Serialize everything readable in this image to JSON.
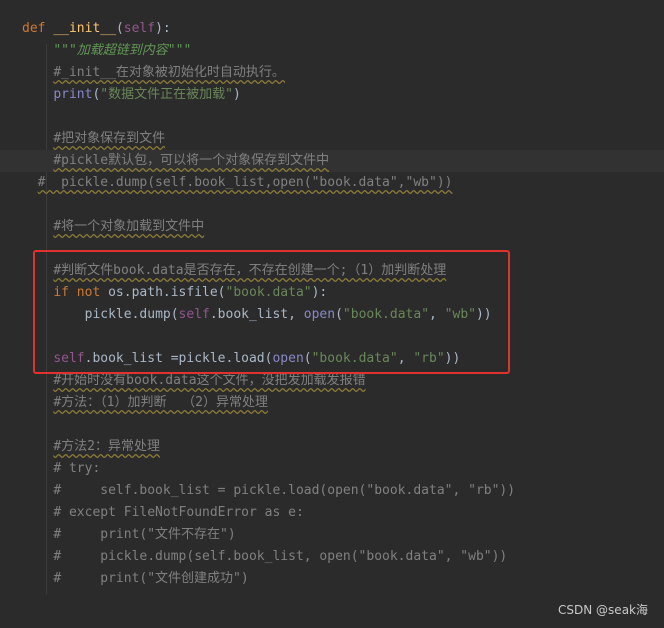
{
  "lines": [
    {
      "segments": [
        {
          "t": "def ",
          "c": "kw"
        },
        {
          "t": "__init__",
          "c": "fn"
        },
        {
          "t": "(",
          "c": "plain"
        },
        {
          "t": "self",
          "c": "self"
        },
        {
          "t": "):",
          "c": "plain"
        }
      ]
    },
    {
      "segments": [
        {
          "t": "    ",
          "c": "plain"
        },
        {
          "t": "\"\"\"加载超链到内容\"\"\"",
          "c": "doc"
        }
      ]
    },
    {
      "segments": [
        {
          "t": "    ",
          "c": "plain"
        },
        {
          "t": "#_init__在对象被初始化时自动执行。",
          "c": "cmt warn"
        }
      ]
    },
    {
      "segments": [
        {
          "t": "    ",
          "c": "plain"
        },
        {
          "t": "print",
          "c": "bi"
        },
        {
          "t": "(",
          "c": "plain"
        },
        {
          "t": "\"数据文件正在被加载\"",
          "c": "str"
        },
        {
          "t": ")",
          "c": "plain"
        }
      ]
    },
    {
      "segments": []
    },
    {
      "segments": [
        {
          "t": "    ",
          "c": "plain"
        },
        {
          "t": "#把对象保存到文件",
          "c": "cmt warn"
        }
      ]
    },
    {
      "segments": [
        {
          "t": "    ",
          "c": "plain"
        },
        {
          "t": "#pickle默认包，可以将一个对象保存到文件中",
          "c": "cmt warn"
        }
      ],
      "highlight": true
    },
    {
      "segments": [
        {
          "t": "  ",
          "c": "plain"
        },
        {
          "t": "#  pickle.dump(self.book_list,open(\"book.data\",\"wb\"))",
          "c": "cmt warn"
        }
      ]
    },
    {
      "segments": []
    },
    {
      "segments": [
        {
          "t": "    ",
          "c": "plain"
        },
        {
          "t": "#将一个对象加载到文件中",
          "c": "cmt warn"
        }
      ]
    },
    {
      "segments": []
    },
    {
      "segments": [
        {
          "t": "    ",
          "c": "plain"
        },
        {
          "t": "#判断文件book.data是否存在，不存在创建一个;（1）加判断处理",
          "c": "cmt warn"
        }
      ]
    },
    {
      "segments": [
        {
          "t": "    ",
          "c": "plain"
        },
        {
          "t": "if not ",
          "c": "kw"
        },
        {
          "t": "os.path.isfile(",
          "c": "plain"
        },
        {
          "t": "\"book.data\"",
          "c": "str"
        },
        {
          "t": "):",
          "c": "plain"
        }
      ]
    },
    {
      "segments": [
        {
          "t": "        ",
          "c": "plain"
        },
        {
          "t": "pickle.dump(",
          "c": "plain"
        },
        {
          "t": "self",
          "c": "self"
        },
        {
          "t": ".book_list, ",
          "c": "plain"
        },
        {
          "t": "open",
          "c": "bi"
        },
        {
          "t": "(",
          "c": "plain"
        },
        {
          "t": "\"book.data\"",
          "c": "str"
        },
        {
          "t": ", ",
          "c": "plain"
        },
        {
          "t": "\"wb\"",
          "c": "str"
        },
        {
          "t": "))",
          "c": "plain"
        }
      ]
    },
    {
      "segments": []
    },
    {
      "segments": [
        {
          "t": "    ",
          "c": "plain"
        },
        {
          "t": "self",
          "c": "self"
        },
        {
          "t": ".book_list =pickle.load(",
          "c": "plain"
        },
        {
          "t": "open",
          "c": "bi"
        },
        {
          "t": "(",
          "c": "plain"
        },
        {
          "t": "\"book.data\"",
          "c": "str"
        },
        {
          "t": ", ",
          "c": "plain"
        },
        {
          "t": "\"rb\"",
          "c": "str"
        },
        {
          "t": "))",
          "c": "plain"
        }
      ]
    },
    {
      "segments": [
        {
          "t": "    ",
          "c": "plain"
        },
        {
          "t": "#开始时没有book.data这个文件，没把发加载发报错",
          "c": "cmt warn"
        }
      ]
    },
    {
      "segments": [
        {
          "t": "    ",
          "c": "plain"
        },
        {
          "t": "#方法：（1）加判断  （2）异常处理",
          "c": "cmt warn"
        }
      ]
    },
    {
      "segments": []
    },
    {
      "segments": [
        {
          "t": "    ",
          "c": "plain"
        },
        {
          "t": "#方法2：异常处理",
          "c": "cmt warn"
        }
      ]
    },
    {
      "segments": [
        {
          "t": "    ",
          "c": "plain"
        },
        {
          "t": "# try:",
          "c": "cmt"
        }
      ]
    },
    {
      "segments": [
        {
          "t": "    ",
          "c": "plain"
        },
        {
          "t": "#     self.book_list = pickle.load(open(\"book.data\", \"rb\"))",
          "c": "cmt"
        }
      ]
    },
    {
      "segments": [
        {
          "t": "    ",
          "c": "plain"
        },
        {
          "t": "# except FileNotFoundError as e:",
          "c": "cmt"
        }
      ]
    },
    {
      "segments": [
        {
          "t": "    ",
          "c": "plain"
        },
        {
          "t": "#     print(\"文件不存在\")",
          "c": "cmt"
        }
      ]
    },
    {
      "segments": [
        {
          "t": "    ",
          "c": "plain"
        },
        {
          "t": "#     pickle.dump(self.book_list, open(\"book.data\", \"wb\"))",
          "c": "cmt"
        }
      ]
    },
    {
      "segments": [
        {
          "t": "    ",
          "c": "plain"
        },
        {
          "t": "#     print(\"文件创建成功\")",
          "c": "cmt"
        }
      ]
    }
  ],
  "watermark": "CSDN @seak海",
  "colors": {
    "background": "#2b2b2b",
    "keyword": "#cc7832",
    "function": "#ffc66d",
    "self": "#94558d",
    "string": "#6a8759",
    "comment": "#808080",
    "highlight_box": "#e0332e"
  }
}
